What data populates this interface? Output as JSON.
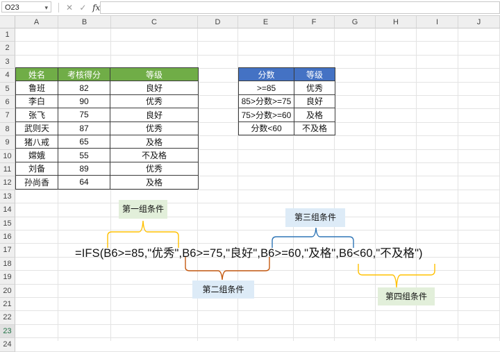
{
  "formula_bar": {
    "name_box": "O23",
    "cancel_icon": "✕",
    "confirm_icon": "✓",
    "fx_label": "fx",
    "content": ""
  },
  "columns": [
    "A",
    "B",
    "C",
    "D",
    "E",
    "F",
    "G",
    "H",
    "I",
    "J"
  ],
  "rows": [
    "1",
    "2",
    "3",
    "4",
    "5",
    "6",
    "7",
    "8",
    "9",
    "10",
    "11",
    "12",
    "13",
    "14",
    "15",
    "16",
    "17",
    "18",
    "19",
    "20",
    "21",
    "22",
    "23",
    "24"
  ],
  "selected_row": "23",
  "score_table": {
    "headers": [
      "姓名",
      "考核得分",
      "等级"
    ],
    "rows": [
      [
        "鲁班",
        "82",
        "良好"
      ],
      [
        "李白",
        "90",
        "优秀"
      ],
      [
        "张飞",
        "75",
        "良好"
      ],
      [
        "武则天",
        "87",
        "优秀"
      ],
      [
        "猪八戒",
        "65",
        "及格"
      ],
      [
        "嫦娥",
        "55",
        "不及格"
      ],
      [
        "刘备",
        "89",
        "优秀"
      ],
      [
        "孙尚香",
        "64",
        "及格"
      ]
    ]
  },
  "rule_table": {
    "headers": [
      "分数",
      "等级"
    ],
    "rows": [
      [
        ">=85",
        "优秀"
      ],
      [
        "85>分数>=75",
        "良好"
      ],
      [
        "75>分数>=60",
        "及格"
      ],
      [
        "分数<60",
        "不及格"
      ]
    ]
  },
  "formula_text": "=IFS(B6>=85,\"优秀\",B6>=75,\"良好\",B6>=60,\"及格\",B6<60,\"不及格\")",
  "annotations": {
    "group1": "第一组条件",
    "group2": "第二组条件",
    "group3": "第三组条件",
    "group4": "第四组条件"
  },
  "colors": {
    "green_header": "#70ad47",
    "blue_header": "#4472c4",
    "bracket_yellow": "#ffc000",
    "bracket_orange": "#c55a11",
    "bracket_blue": "#2e75b6"
  }
}
